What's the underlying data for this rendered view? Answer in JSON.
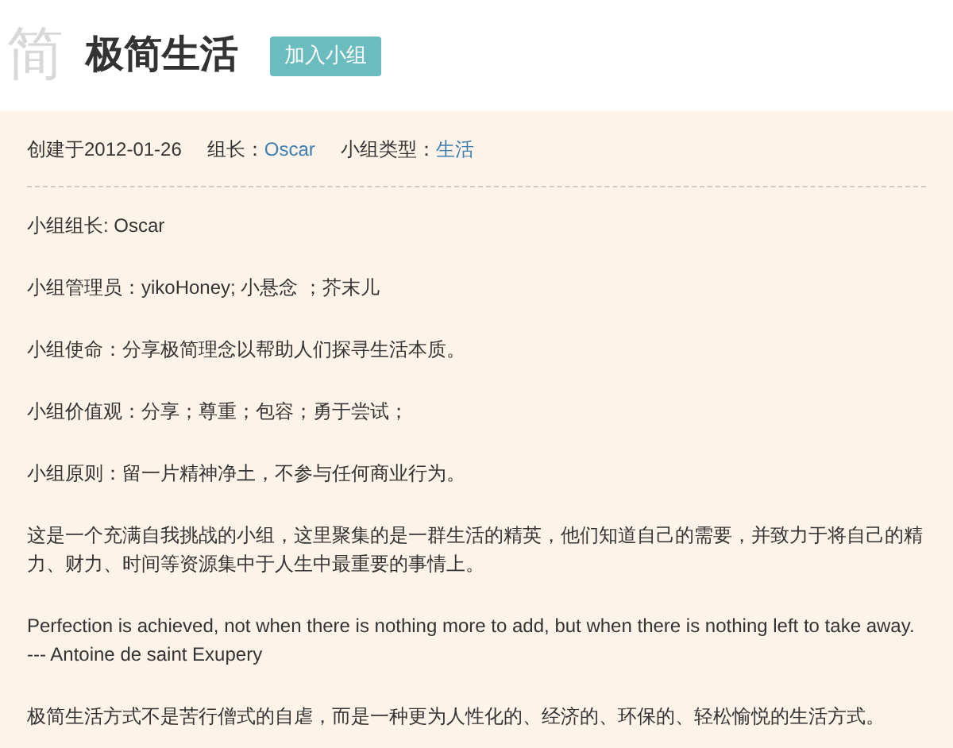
{
  "header": {
    "logo_char": "简",
    "title": "极简生活",
    "join_button": "加入小组"
  },
  "meta": {
    "created": "创建于2012-01-26",
    "leader_label": "组长：",
    "leader": "Oscar",
    "type_label": "小组类型：",
    "type": "生活"
  },
  "paragraphs": [
    "小组组长: Oscar",
    "小组管理员：yikoHoney; 小悬念 ；芥末儿",
    "小组使命：分享极简理念以帮助人们探寻生活本质。",
    "小组价值观：分享；尊重；包容；勇于尝试；",
    "小组原则：留一片精神净土，不参与任何商业行为。",
    "这是一个充满自我挑战的小组，这里聚集的是一群生活的精英，他们知道自己的需要，并致力于将自己的精力、财力、时间等资源集中于人生中最重要的事情上。",
    "Perfection is achieved, not when there is nothing more to add, but when there is nothing left to take away. --- Antoine de saint Exupery",
    "极简生活方式不是苦行僧式的自虐，而是一种更为人性化的、经济的、环保的、轻松愉悦的生活方式。"
  ]
}
